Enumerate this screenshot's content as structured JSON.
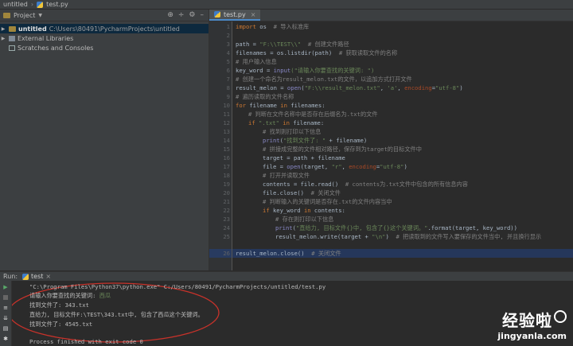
{
  "breadcrumb": {
    "project": "untitled",
    "file": "test.py"
  },
  "project_panel": {
    "title": "Project",
    "tree": [
      {
        "name": "untitled",
        "path": "C:\\Users\\80491\\PycharmProjects\\untitled"
      },
      {
        "name": "External Libraries"
      },
      {
        "name": "Scratches and Consoles"
      }
    ]
  },
  "editor": {
    "tab": "test.py",
    "current_line": 26,
    "line_numbers": [
      "1",
      "2",
      "3",
      "4",
      "5",
      "6",
      "7",
      "8",
      "9",
      "10",
      "11",
      "12",
      "13",
      "14",
      "15",
      "16",
      "17",
      "18",
      "19",
      "20",
      "21",
      "22",
      "23",
      "24",
      "25",
      "26"
    ]
  },
  "code_lines": {
    "l1_kw": "import",
    "l1_rest": " os  ",
    "l1_cm": "# 导入标准库",
    "l3_a": "path = ",
    "l3_str": "\"F:\\\\TEST\\\\\"",
    "l3_cm": "  # 创建文件路径",
    "l4_a": "filenames = os.listdir(path)  ",
    "l4_cm": "# 获取读取文件的名称",
    "l5_cm": "# 用户输入信息",
    "l6_a": "key_word = ",
    "l6_bi": "input",
    "l6_str": "(\"请输入你要查找的关键词: \")",
    "l7_cm": "# 创建一个命名为result_melon.txt的文件，以追加方式打开文件",
    "l8_a": "result_melon = ",
    "l8_bi": "open",
    "l8_b": "(",
    "l8_str1": "\"F:\\\\result_melon.txt\"",
    "l8_c": ", ",
    "l8_str2": "'a'",
    "l8_d": ", ",
    "l8_kwarg": "encoding",
    "l8_e": "=",
    "l8_str3": "\"utf-8\"",
    "l8_f": ")",
    "l9_cm": "# 遍历读取的文件名称",
    "l10_kw": "for",
    "l10_a": " filename ",
    "l10_kw2": "in",
    "l10_b": " filenames:",
    "l11_cm": "# 判断在文件名称中是否存在后缀名为.txt的文件",
    "l12_kw": "if",
    "l12_str": " \".txt\"",
    "l12_kw2": " in",
    "l12_b": " filename:",
    "l13_cm": "# 找到则打印以下信息",
    "l14_bi": "print",
    "l14_a": "(",
    "l14_str": "\"找到文件了: \"",
    "l14_b": " + filename)",
    "l15_cm": "# 拼接成完整的文件相对路径，保存到为target的目标文件中",
    "l16_a": "target = path + filename",
    "l17_a": "file = ",
    "l17_bi": "open",
    "l17_b": "(target, ",
    "l17_str": "\"r\"",
    "l17_c": ", ",
    "l17_kwarg": "encoding",
    "l17_d": "=",
    "l17_str2": "\"utf-8\"",
    "l17_e": ")",
    "l18_cm": "# 打开并读取文件",
    "l19_a": "contents = file.read()  ",
    "l19_cm": "# contents为.txt文件中包含的所有信息内容",
    "l20_a": "file.close()  ",
    "l20_cm": "# 关闭文件",
    "l21_cm": "# 判断输入的关键词是否存在.txt的文件内容当中",
    "l22_kw": "if",
    "l22_a": " key_word ",
    "l22_kw2": "in",
    "l22_b": " contents:",
    "l23_cm": "# 存在则打印以下信息",
    "l24_bi": "print",
    "l24_a": "(",
    "l24_str": "\"直给力, 目标文件{}中, 包含了{}这个关键词。\"",
    "l24_b": ".format(target, key_word))",
    "l25_a": "result_melon.write(target + ",
    "l25_str": "\"\\n\"",
    "l25_b": ")  ",
    "l25_cm": "# 把读取到的文件写入要保存的文件当中, 并且换行显示",
    "l26_a": "result_melon.close()  ",
    "l26_cm": "# 关闭文件"
  },
  "run_panel": {
    "label": "Run:",
    "tab": "test",
    "output": [
      "\"C:\\Program Files\\Python37\\python.exe\" C:/Users/80491/PycharmProjects/untitled/test.py",
      "请输入你要查找的关键词: ",
      "找到文件了: 343.txt",
      "直给力, 目标文件F:\\TEST\\343.txt中, 包含了西瓜这个关键词。",
      "找到文件了: 4545.txt",
      "",
      "Process finished with exit code 0"
    ],
    "input_value": "西瓜"
  },
  "watermark": {
    "cn": "经验啦",
    "url": "jingyanla.com"
  },
  "colors": {
    "bg": "#2b2b2b",
    "keyword": "#cc7832",
    "string": "#6a8759",
    "comment": "#808080",
    "selection": "#214283"
  }
}
